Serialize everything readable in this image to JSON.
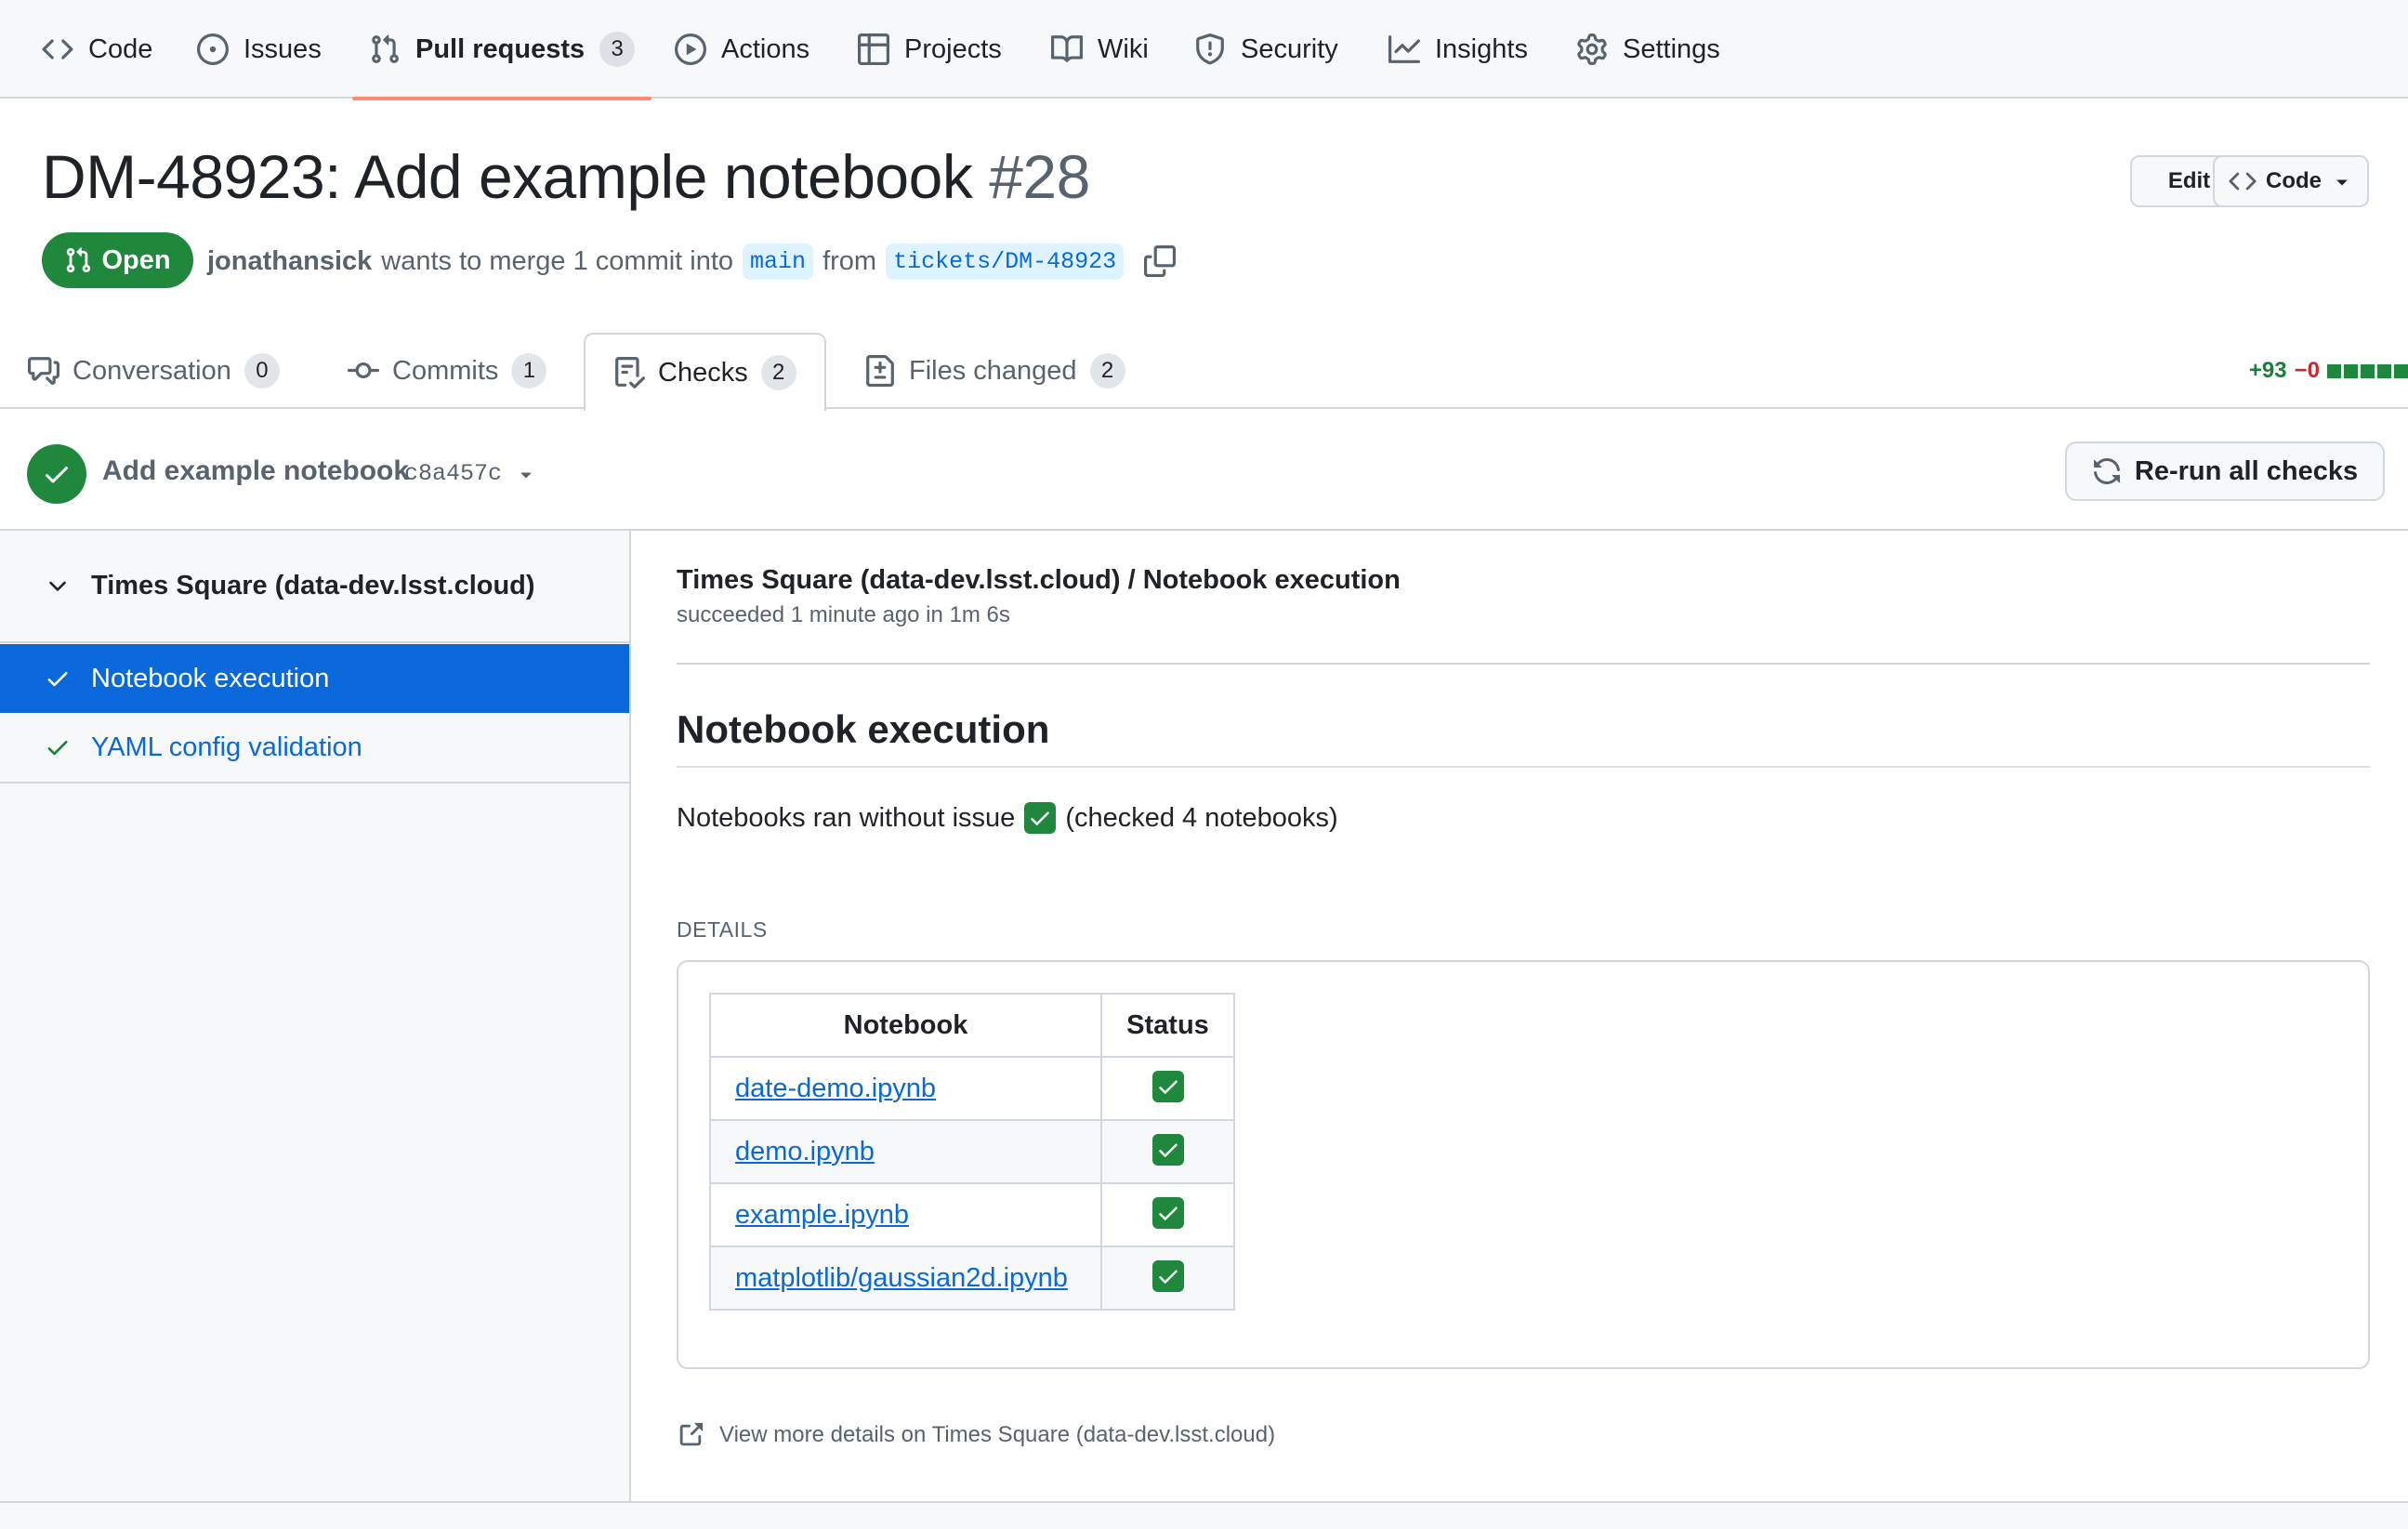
{
  "repo_nav": {
    "items": [
      {
        "label": "Code",
        "icon": "code-icon"
      },
      {
        "label": "Issues",
        "icon": "issue-icon"
      },
      {
        "label": "Pull requests",
        "icon": "pull-request-icon",
        "count": "3"
      },
      {
        "label": "Actions",
        "icon": "play-icon"
      },
      {
        "label": "Projects",
        "icon": "table-icon"
      },
      {
        "label": "Wiki",
        "icon": "book-icon"
      },
      {
        "label": "Security",
        "icon": "shield-icon"
      },
      {
        "label": "Insights",
        "icon": "graph-icon"
      },
      {
        "label": "Settings",
        "icon": "gear-icon"
      }
    ],
    "active_index": 2,
    "active_underline_color": "#fd8c73"
  },
  "pr": {
    "title": "DM-48923: Add example notebook",
    "number": "#28",
    "edit_label": "Edit",
    "code_label": "Code",
    "state": "Open",
    "state_color": "#1f883d",
    "author": "jonathansick",
    "merge_text": "wants to merge 1 commit into",
    "base_branch": "main",
    "from_text": "from",
    "head_branch": "tickets/DM-48923"
  },
  "pr_tabs": [
    {
      "label": "Conversation",
      "count": "0",
      "icon": "comment-icon"
    },
    {
      "label": "Commits",
      "count": "1",
      "icon": "commit-icon"
    },
    {
      "label": "Checks",
      "count": "2",
      "icon": "checklist-icon"
    },
    {
      "label": "Files changed",
      "count": "2",
      "icon": "file-diff-icon"
    }
  ],
  "diffstat": {
    "additions": "+93",
    "deletions": "−0"
  },
  "commit": {
    "message": "Add example notebook",
    "sha": "c8a457c",
    "rerun_label": "Re-run all checks"
  },
  "sidebar": {
    "suite_name": "Times Square (data-dev.lsst.cloud)",
    "runs": [
      {
        "label": "Notebook execution",
        "selected": true
      },
      {
        "label": "YAML config validation",
        "selected": false
      }
    ],
    "selected_color": "#0969da"
  },
  "check_run": {
    "title": "Times Square (data-dev.lsst.cloud) / Notebook execution",
    "status": "succeeded 1 minute ago in 1m 6s",
    "output_heading": "Notebook execution",
    "summary_prefix": "Notebooks ran without issue",
    "summary_suffix": "(checked 4 notebooks)",
    "details_label": "DETAILS",
    "table": {
      "headers": [
        "Notebook",
        "Status"
      ],
      "rows": [
        {
          "notebook": "date-demo.ipynb",
          "status": "✅"
        },
        {
          "notebook": "demo.ipynb",
          "status": "✅"
        },
        {
          "notebook": "example.ipynb",
          "status": "✅"
        },
        {
          "notebook": "matplotlib/gaussian2d.ipynb",
          "status": "✅"
        }
      ]
    },
    "external_link": "View more details on Times Square (data-dev.lsst.cloud)"
  }
}
